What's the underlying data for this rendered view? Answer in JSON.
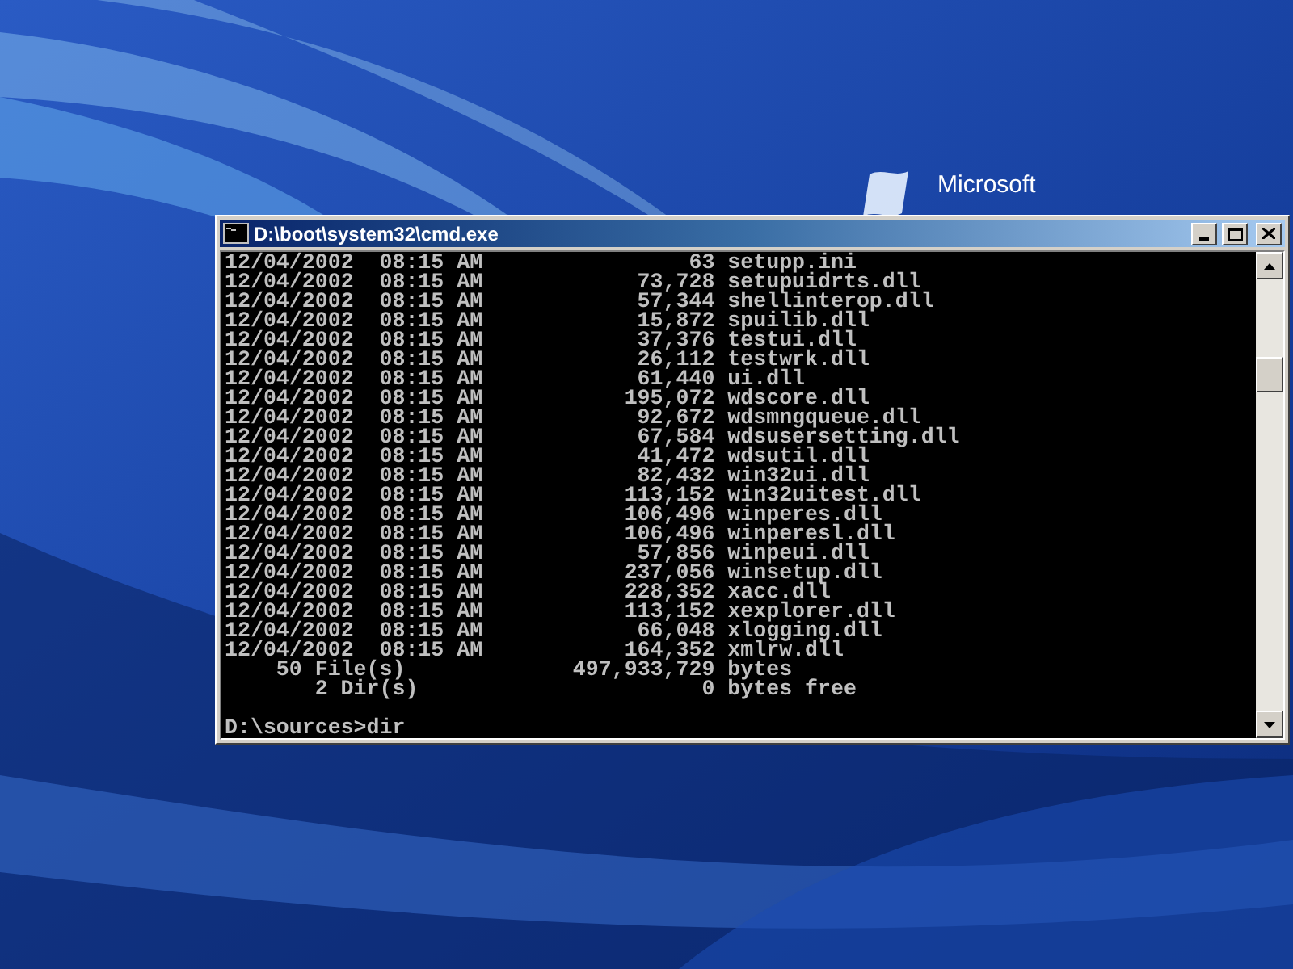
{
  "desktop": {
    "logo": {
      "text": "Microsoft"
    }
  },
  "window": {
    "title": "D:\\boot\\system32\\cmd.exe"
  },
  "console": {
    "entries": [
      {
        "date": "12/04/2002",
        "time": "08:15 AM",
        "size": "63",
        "name": "setupp.ini"
      },
      {
        "date": "12/04/2002",
        "time": "08:15 AM",
        "size": "73,728",
        "name": "setupuidrts.dll"
      },
      {
        "date": "12/04/2002",
        "time": "08:15 AM",
        "size": "57,344",
        "name": "shellinterop.dll"
      },
      {
        "date": "12/04/2002",
        "time": "08:15 AM",
        "size": "15,872",
        "name": "spuilib.dll"
      },
      {
        "date": "12/04/2002",
        "time": "08:15 AM",
        "size": "37,376",
        "name": "testui.dll"
      },
      {
        "date": "12/04/2002",
        "time": "08:15 AM",
        "size": "26,112",
        "name": "testwrk.dll"
      },
      {
        "date": "12/04/2002",
        "time": "08:15 AM",
        "size": "61,440",
        "name": "ui.dll"
      },
      {
        "date": "12/04/2002",
        "time": "08:15 AM",
        "size": "195,072",
        "name": "wdscore.dll"
      },
      {
        "date": "12/04/2002",
        "time": "08:15 AM",
        "size": "92,672",
        "name": "wdsmngqueue.dll"
      },
      {
        "date": "12/04/2002",
        "time": "08:15 AM",
        "size": "67,584",
        "name": "wdsusersetting.dll"
      },
      {
        "date": "12/04/2002",
        "time": "08:15 AM",
        "size": "41,472",
        "name": "wdsutil.dll"
      },
      {
        "date": "12/04/2002",
        "time": "08:15 AM",
        "size": "82,432",
        "name": "win32ui.dll"
      },
      {
        "date": "12/04/2002",
        "time": "08:15 AM",
        "size": "113,152",
        "name": "win32uitest.dll"
      },
      {
        "date": "12/04/2002",
        "time": "08:15 AM",
        "size": "106,496",
        "name": "winperes.dll"
      },
      {
        "date": "12/04/2002",
        "time": "08:15 AM",
        "size": "106,496",
        "name": "winperesl.dll"
      },
      {
        "date": "12/04/2002",
        "time": "08:15 AM",
        "size": "57,856",
        "name": "winpeui.dll"
      },
      {
        "date": "12/04/2002",
        "time": "08:15 AM",
        "size": "237,056",
        "name": "winsetup.dll"
      },
      {
        "date": "12/04/2002",
        "time": "08:15 AM",
        "size": "228,352",
        "name": "xacc.dll"
      },
      {
        "date": "12/04/2002",
        "time": "08:15 AM",
        "size": "113,152",
        "name": "xexplorer.dll"
      },
      {
        "date": "12/04/2002",
        "time": "08:15 AM",
        "size": "66,048",
        "name": "xlogging.dll"
      },
      {
        "date": "12/04/2002",
        "time": "08:15 AM",
        "size": "164,352",
        "name": "xmlrw.dll"
      }
    ],
    "summary": [
      {
        "count": "50 File(s)",
        "amount": "497,933,729",
        "unit": "bytes"
      },
      {
        "count": "2 Dir(s)",
        "amount": "0",
        "unit": "bytes free"
      }
    ],
    "prompt": "D:\\sources>dir"
  }
}
